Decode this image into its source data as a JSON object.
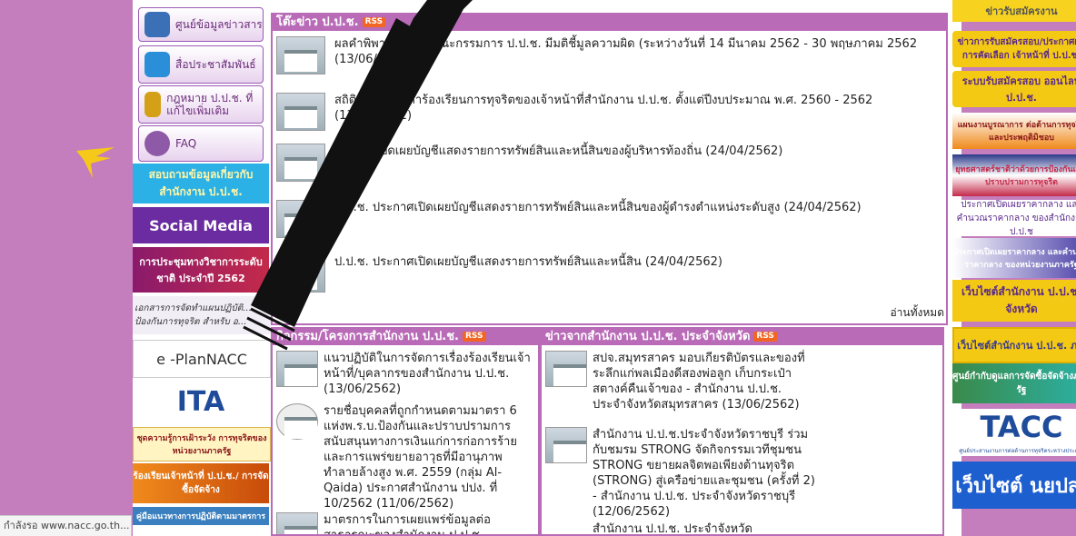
{
  "left_menu": {
    "news_info": "ศูนย์ข้อมูลข่าวสาร",
    "pr_media": "สื่อประชาสัมพันธ์",
    "law": "กฎหมาย ป.ป.ช. ที่แก้ไขเพิ่มเติม",
    "faq": "FAQ",
    "ask_banner": "สอบถามข้อมูลเกี่ยวกับ สำนักงาน ป.ป.ช.",
    "social_banner": "Social Media",
    "conference_banner": "การประชุมทางวิชาการระดับชาติ ประจำปี 2562",
    "plan_banner": "เอกสารการจัดทำแผนปฏิบัติ... ป้องกันการทุจริต สำหรับ อ...",
    "eplan": "e -PlanNACC",
    "ita": "ITA",
    "service_banner": "ชุดความรู้การเฝ้าระวัง การทุจริตของหน่วยงานภาครัฐ",
    "complaint_banner": "ร้องเรียนเจ้าหน้าที่ ป.ป.ช./ การจัดซื้อจัดจ้าง",
    "bottom_banner": "คู่มือแนวทางการปฏิบัติตามมาตรการ"
  },
  "news_board": {
    "title": "โต๊ะข่าว ป.ป.ช.",
    "rss": "RSS",
    "items": [
      {
        "text": "ผลคำพิพากษาคดีที่คณะกรรมการ ป.ป.ช. มีมติชี้มูลความผิด (ระหว่างวันที่ 14 มีนาคม 2562 - 30 พฤษภาคม 2562 (13/06/2562)"
      },
      {
        "text": "สถิติเรื่องกล่าวหาร้องเรียนการทุจริตของเจ้าหน้าที่สำนักงาน ป.ป.ช. ตั้งแต่ปีงบประมาณ พ.ศ. 2560 - 2562 (13/06/2562)"
      },
      {
        "text": "ประกาศเปิดเผยบัญชีแสดงรายการทรัพย์สินและหนี้สินของผู้บริหารท้องถิ่น (24/04/2562)"
      },
      {
        "text": "ป.ป.ช. ประกาศเปิดเผยบัญชีแสดงรายการทรัพย์สินและหนี้สินของผู้ดำรงตำแหน่งระดับสูง (24/04/2562)"
      },
      {
        "text": "ป.ป.ช. ประกาศเปิดเผยบัญชีแสดงรายการทรัพย์สินและหนี้สิน (24/04/2562)"
      }
    ],
    "read_all": "อ่านทั้งหมด"
  },
  "activity_board": {
    "title": "กิจกรรม/โครงการสำนักงาน ป.ป.ช.",
    "rss": "RSS",
    "items": [
      {
        "text": "แนวปฏิบัติในการจัดการเรื่องร้องเรียนเจ้าหน้าที่/บุคลากรของสำนักงาน ป.ป.ช. (13/06/2562)"
      },
      {
        "text": "รายชื่อบุคคลที่ถูกกำหนดตามมาตรา 6 แห่งพ.ร.บ.ป้องกันและปราบปรามการสนับสนุนทางการเงินแก่การก่อการร้ายและการแพร่ขยายอาวุธที่มีอานุภาพทำลายล้างสูง พ.ศ. 2559 (กลุ่ม Al-Qaida) ประกาศสำนักงาน ปปง. ที่ 10/2562 (11/06/2562)"
      },
      {
        "text": "มาตรการในการเผยแพร่ข้อมูลต่อสาธารณะของสำนักงาน ป.ป.ช."
      }
    ]
  },
  "province_board": {
    "title": "ข่าวจากสำนักงาน ป.ป.ช. ประจำจังหวัด",
    "rss": "RSS",
    "items": [
      {
        "text": "สปจ.สมุทรสาคร มอบเกียรติบัตรและของที่ระลึกแก่พลเมืองดีสองพ่อลูก เก็บกระเป๋าสตางค์คืนเจ้าของ - สำนักงาน ป.ป.ช. ประจำจังหวัดสมุทรสาคร (13/06/2562)"
      },
      {
        "text": "สำนักงาน ป.ป.ช.ประจำจังหวัดราชบุรี ร่วมกับชมรม STRONG จัดกิจกรรมเวทีชุมชน STRONG ขยายผลจิตพอเพียงต้านทุจริต (STRONG) สู่เครือข่ายและชุมชน (ครั้งที่ 2) - สำนักงาน ป.ป.ช. ประจำจังหวัดราชบุรี (12/06/2562)"
      },
      {
        "text": "สำนักงาน ป.ป.ช. ประจำจังหวัด"
      }
    ]
  },
  "right_menu": {
    "top_partial": "ข่าวรับสมัครงาน",
    "recruit": "ข่าวการรับสมัครสอบ/ประกาศผลการคัดเลือก เจ้าหน้าที่ ป.ป.ช.",
    "online_exam": "ระบบรับสมัครสอบ ออนไลน์ ป.ป.ช.",
    "plan": "แผนงานบูรณาการ ต่อต้านการทุจริตและประพฤติมิชอบ",
    "strategy": "ยุทธศาสตร์ชาติว่าด้วยการป้องกันและปราบปรามการทุจริต",
    "price_nacc": "ประกาศเปิดเผยราคากลาง และคำนวณราคากลาง ของสำนักงาน ป.ป.ช",
    "price_gov": "ประกาศเปิดเผยราคากลาง และคำนวณราคากลาง ของหน่วยงานภาครัฐ",
    "province_site": "เว็บไซต์สำนักงาน ป.ป.ช. จังหวัด",
    "region_site": "เว็บไซต์สำนักงาน ป.ป.ช. ภาค",
    "procurement": "ศูนย์กำกับดูแลการจัดซื้อจัดจ้างภาครัฐ",
    "tacc": "TACC",
    "tacc_sub": "ศูนย์ประสานงานการต่อต้านการทุจริตระหว่างประเทศ",
    "nyps": "เว็บไซต์ นยปส."
  },
  "status_bar": "กำลังรอ www.nacc.go.th..."
}
